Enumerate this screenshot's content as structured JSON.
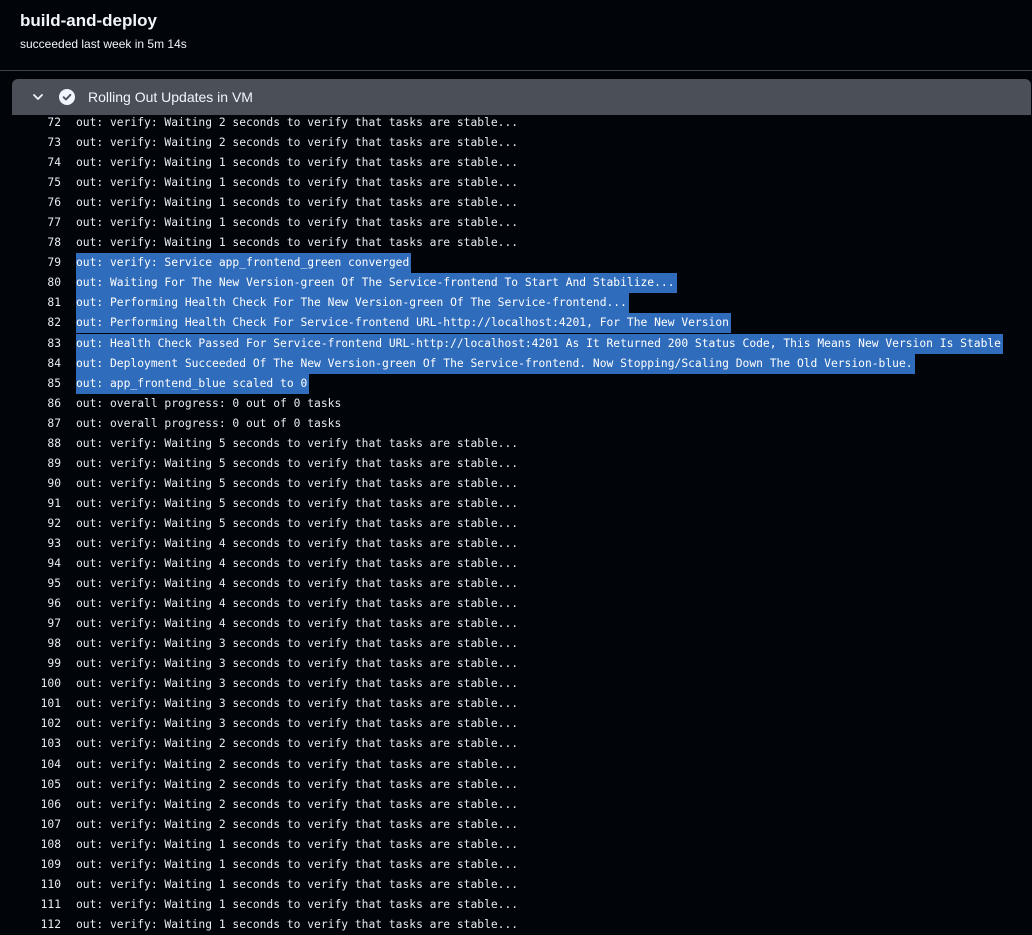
{
  "job": {
    "title": "build-and-deploy",
    "status": "succeeded last week in 5m 14s"
  },
  "step": {
    "label": "Rolling Out Updates in VM",
    "expand_icon": "chevron-down-icon",
    "status_icon": "check-circle-icon",
    "status": "success"
  },
  "colors": {
    "background": "#010409",
    "step_bar": "#4b5058",
    "selection": "#2f6cbc",
    "text": "#e6edf3"
  },
  "log": {
    "selected_lines": [
      79,
      80,
      81,
      82,
      83,
      84,
      85
    ],
    "lines": [
      {
        "n": "72",
        "text": "out: verify: Waiting 2 seconds to verify that tasks are stable..."
      },
      {
        "n": "73",
        "text": "out: verify: Waiting 2 seconds to verify that tasks are stable..."
      },
      {
        "n": "74",
        "text": "out: verify: Waiting 1 seconds to verify that tasks are stable..."
      },
      {
        "n": "75",
        "text": "out: verify: Waiting 1 seconds to verify that tasks are stable..."
      },
      {
        "n": "76",
        "text": "out: verify: Waiting 1 seconds to verify that tasks are stable..."
      },
      {
        "n": "77",
        "text": "out: verify: Waiting 1 seconds to verify that tasks are stable..."
      },
      {
        "n": "78",
        "text": "out: verify: Waiting 1 seconds to verify that tasks are stable..."
      },
      {
        "n": "79",
        "text": "out: verify: Service app_frontend_green converged"
      },
      {
        "n": "80",
        "text": "out: Waiting For The New Version-green Of The Service-frontend To Start And Stabilize..."
      },
      {
        "n": "81",
        "text": "out: Performing Health Check For The New Version-green Of The Service-frontend..."
      },
      {
        "n": "82",
        "text": "out: Performing Health Check For Service-frontend URL-http://localhost:4201, For The New Version"
      },
      {
        "n": "83",
        "text": "out: Health Check Passed For Service-frontend URL-http://localhost:4201 As It Returned 200 Status Code, This Means New Version Is Stable"
      },
      {
        "n": "84",
        "text": "out: Deployment Succeeded Of The New Version-green Of The Service-frontend. Now Stopping/Scaling Down The Old Version-blue."
      },
      {
        "n": "85",
        "text": "out: app_frontend_blue scaled to 0"
      },
      {
        "n": "86",
        "text": "out: overall progress: 0 out of 0 tasks"
      },
      {
        "n": "87",
        "text": "out: overall progress: 0 out of 0 tasks"
      },
      {
        "n": "88",
        "text": "out: verify: Waiting 5 seconds to verify that tasks are stable..."
      },
      {
        "n": "89",
        "text": "out: verify: Waiting 5 seconds to verify that tasks are stable..."
      },
      {
        "n": "90",
        "text": "out: verify: Waiting 5 seconds to verify that tasks are stable..."
      },
      {
        "n": "91",
        "text": "out: verify: Waiting 5 seconds to verify that tasks are stable..."
      },
      {
        "n": "92",
        "text": "out: verify: Waiting 5 seconds to verify that tasks are stable..."
      },
      {
        "n": "93",
        "text": "out: verify: Waiting 4 seconds to verify that tasks are stable..."
      },
      {
        "n": "94",
        "text": "out: verify: Waiting 4 seconds to verify that tasks are stable..."
      },
      {
        "n": "95",
        "text": "out: verify: Waiting 4 seconds to verify that tasks are stable..."
      },
      {
        "n": "96",
        "text": "out: verify: Waiting 4 seconds to verify that tasks are stable..."
      },
      {
        "n": "97",
        "text": "out: verify: Waiting 4 seconds to verify that tasks are stable..."
      },
      {
        "n": "98",
        "text": "out: verify: Waiting 3 seconds to verify that tasks are stable..."
      },
      {
        "n": "99",
        "text": "out: verify: Waiting 3 seconds to verify that tasks are stable..."
      },
      {
        "n": "100",
        "text": "out: verify: Waiting 3 seconds to verify that tasks are stable..."
      },
      {
        "n": "101",
        "text": "out: verify: Waiting 3 seconds to verify that tasks are stable..."
      },
      {
        "n": "102",
        "text": "out: verify: Waiting 3 seconds to verify that tasks are stable..."
      },
      {
        "n": "103",
        "text": "out: verify: Waiting 2 seconds to verify that tasks are stable..."
      },
      {
        "n": "104",
        "text": "out: verify: Waiting 2 seconds to verify that tasks are stable..."
      },
      {
        "n": "105",
        "text": "out: verify: Waiting 2 seconds to verify that tasks are stable..."
      },
      {
        "n": "106",
        "text": "out: verify: Waiting 2 seconds to verify that tasks are stable..."
      },
      {
        "n": "107",
        "text": "out: verify: Waiting 2 seconds to verify that tasks are stable..."
      },
      {
        "n": "108",
        "text": "out: verify: Waiting 1 seconds to verify that tasks are stable..."
      },
      {
        "n": "109",
        "text": "out: verify: Waiting 1 seconds to verify that tasks are stable..."
      },
      {
        "n": "110",
        "text": "out: verify: Waiting 1 seconds to verify that tasks are stable..."
      },
      {
        "n": "111",
        "text": "out: verify: Waiting 1 seconds to verify that tasks are stable..."
      },
      {
        "n": "112",
        "text": "out: verify: Waiting 1 seconds to verify that tasks are stable..."
      }
    ]
  }
}
